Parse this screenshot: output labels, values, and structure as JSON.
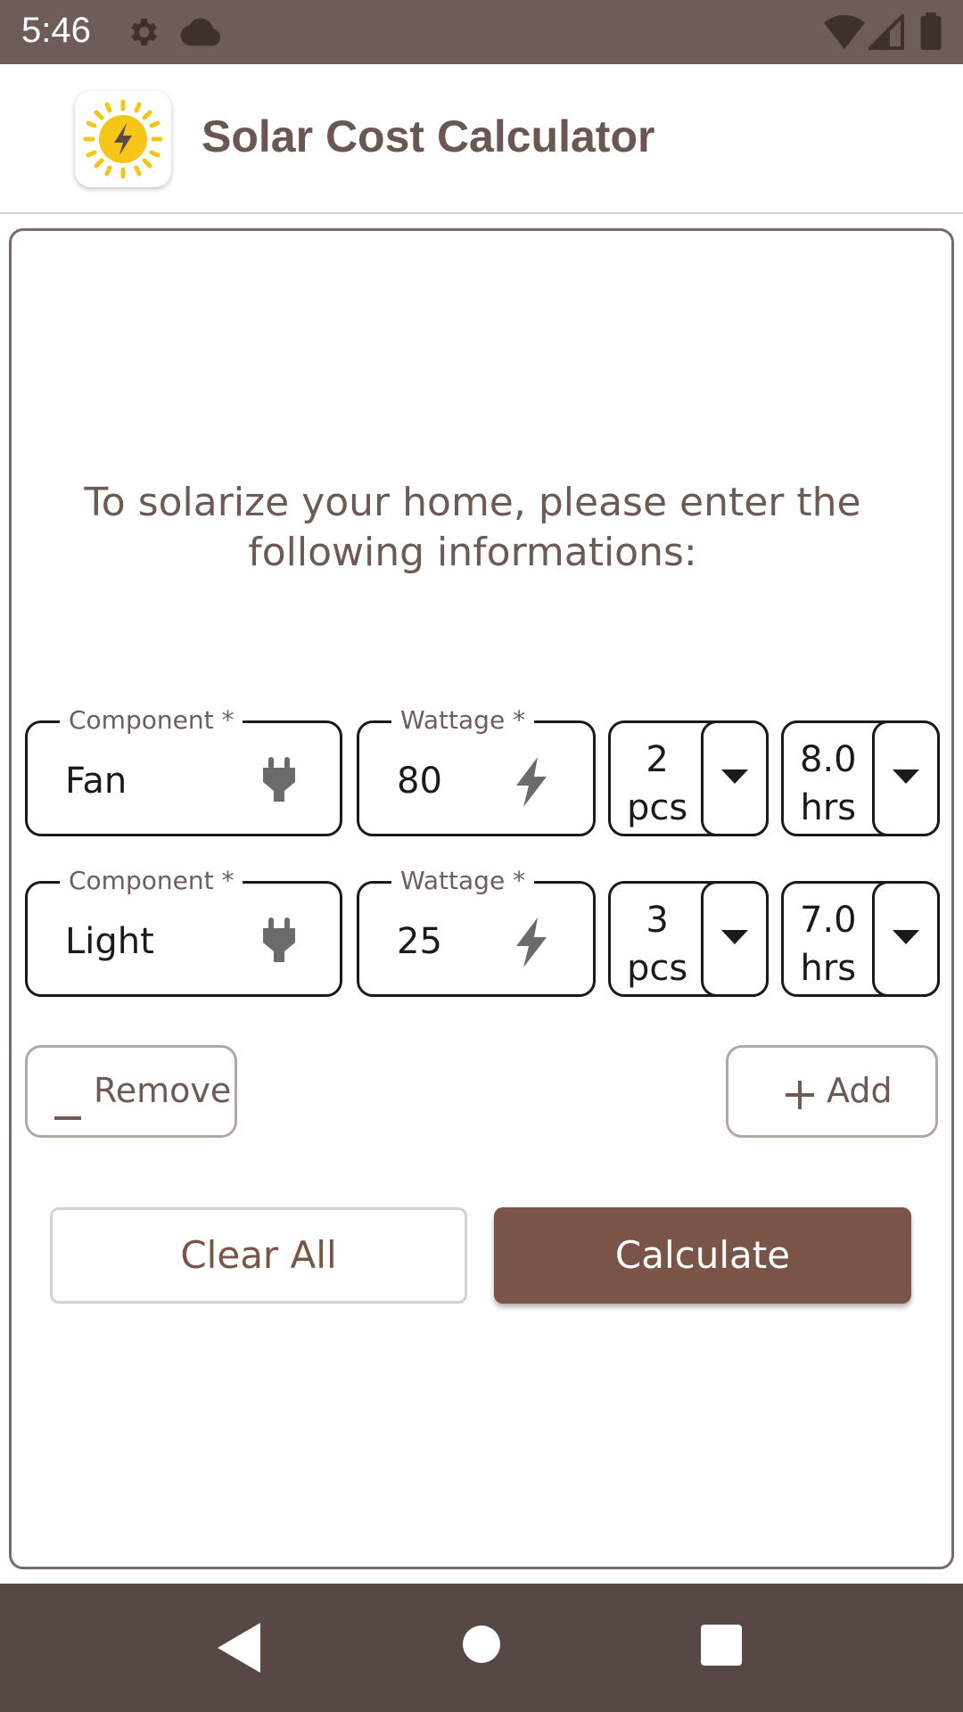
{
  "status_bar": {
    "time": "5:46",
    "icons": [
      "gear-icon",
      "cloud-icon",
      "wifi-icon",
      "signal-icon",
      "battery-icon"
    ]
  },
  "app_bar": {
    "title": "Solar Cost Calculator",
    "logo_icon": "sun-bolt-icon"
  },
  "intro_text": "To solarize your home, please enter the following informations:",
  "rows": [
    {
      "component_label": "Component *",
      "component_value": "Fan",
      "wattage_label": "Wattage *",
      "wattage_value": "80",
      "qty_value": "2",
      "qty_unit": "pcs",
      "hours_value": "8.0",
      "hours_unit": "hrs"
    },
    {
      "component_label": "Component *",
      "component_value": "Light",
      "wattage_label": "Wattage *",
      "wattage_value": "25",
      "qty_value": "3",
      "qty_unit": "pcs",
      "hours_value": "7.0",
      "hours_unit": "hrs"
    }
  ],
  "actions": {
    "remove_label": "Remove",
    "add_label": "Add",
    "clear_label": "Clear All",
    "calculate_label": "Calculate"
  },
  "colors": {
    "status_bar": "#6e5c58",
    "accent": "#7a5547",
    "nav_bar": "#574845",
    "text_brown": "#6e5a55"
  }
}
